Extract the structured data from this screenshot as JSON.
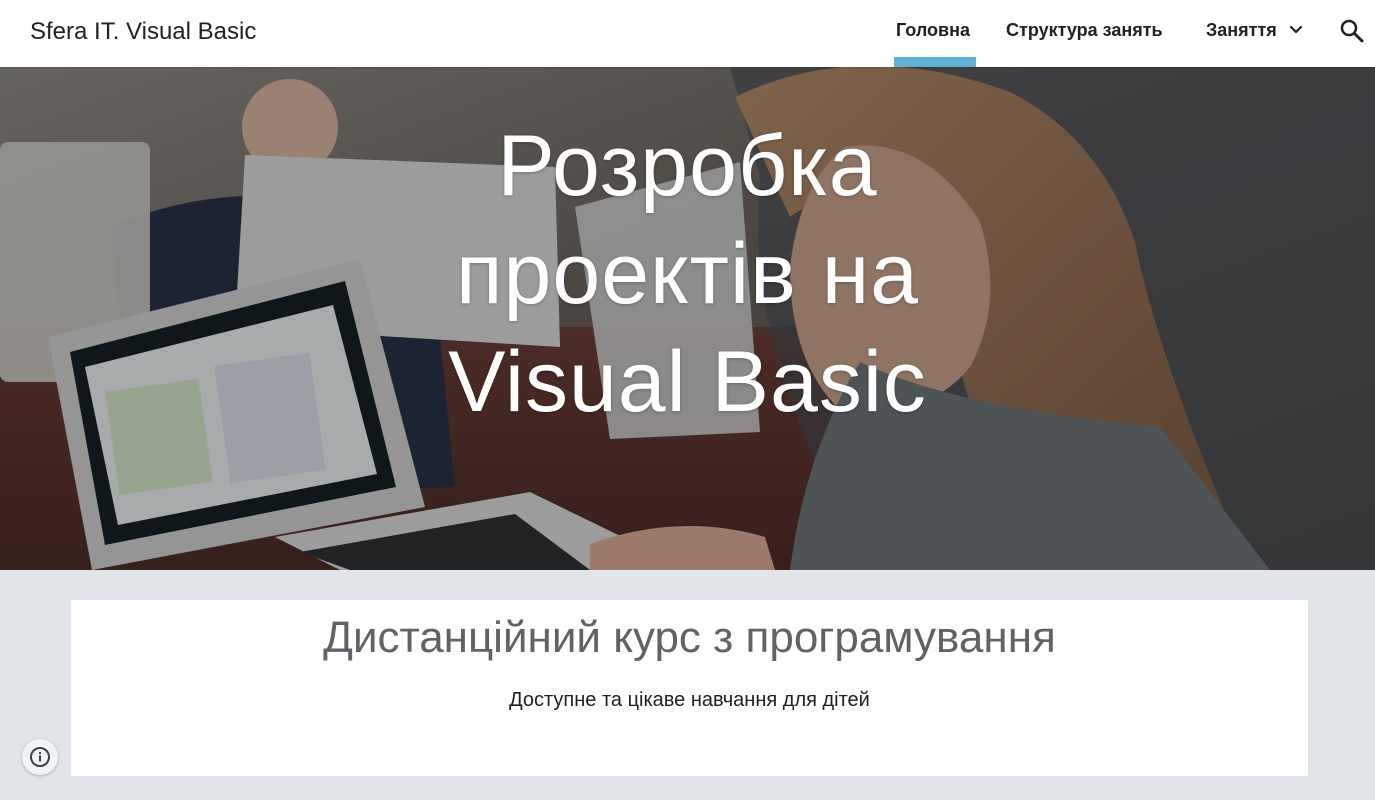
{
  "header": {
    "site_title": "Sfera IT. Visual Basic",
    "nav": {
      "home": "Головна",
      "structure": "Структура занять",
      "lessons": "Заняття"
    },
    "active_item": "Головна",
    "accent_color": "#5fb2d2"
  },
  "hero": {
    "title_lines": [
      "Розробка",
      "проектів на",
      "Visual Basic"
    ],
    "background_image": "children working on laptops in a classroom"
  },
  "content": {
    "heading": "Дистанційний курс з програмування",
    "subheading": "Доступне та цікаве навчання для дітей"
  },
  "icons": {
    "search": "search-icon",
    "chevron": "chevron-down-icon",
    "info": "info-icon"
  }
}
